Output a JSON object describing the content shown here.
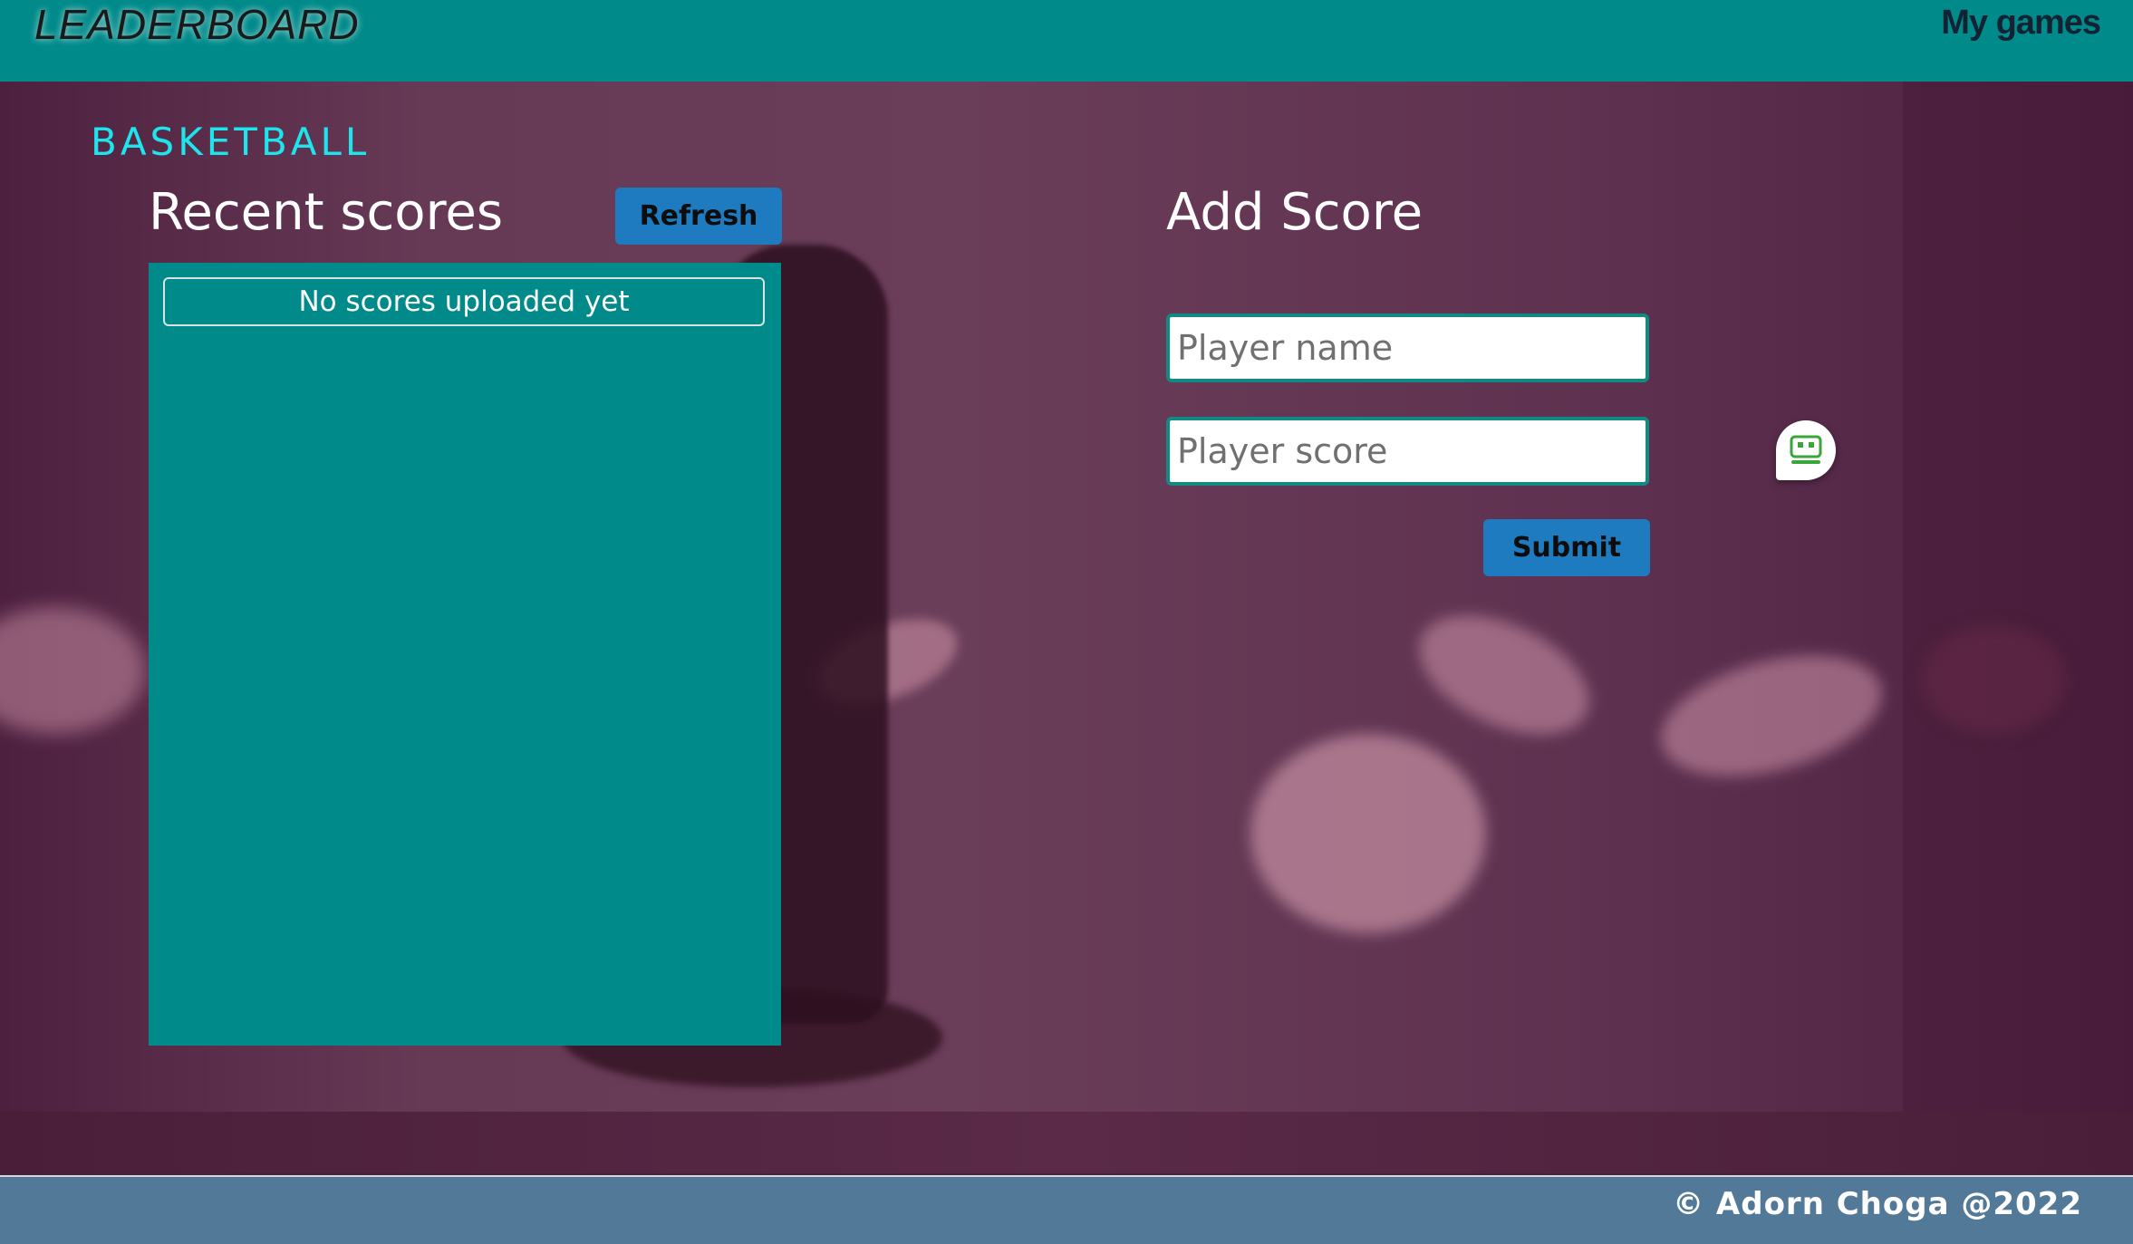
{
  "header": {
    "logo": "LEADERBOARD",
    "nav_link": "My games"
  },
  "main": {
    "category": "BASKETBALL",
    "recent_scores": {
      "title": "Recent scores",
      "refresh_label": "Refresh",
      "empty_message": "No scores uploaded yet"
    },
    "add_score": {
      "title": "Add Score",
      "player_name_placeholder": "Player name",
      "player_score_placeholder": "Player score",
      "submit_label": "Submit"
    }
  },
  "footer": {
    "copyright": "© Adorn Choga @2022"
  },
  "icons": {
    "chat": "chat-bot-icon"
  },
  "colors": {
    "header_bg": "#018a8a",
    "panel_bg": "#018a8a",
    "button_bg": "#1f7bbf",
    "category_text": "#1ee4ec",
    "footer_bg": "#537999",
    "widget_icon": "#3aa63a"
  }
}
